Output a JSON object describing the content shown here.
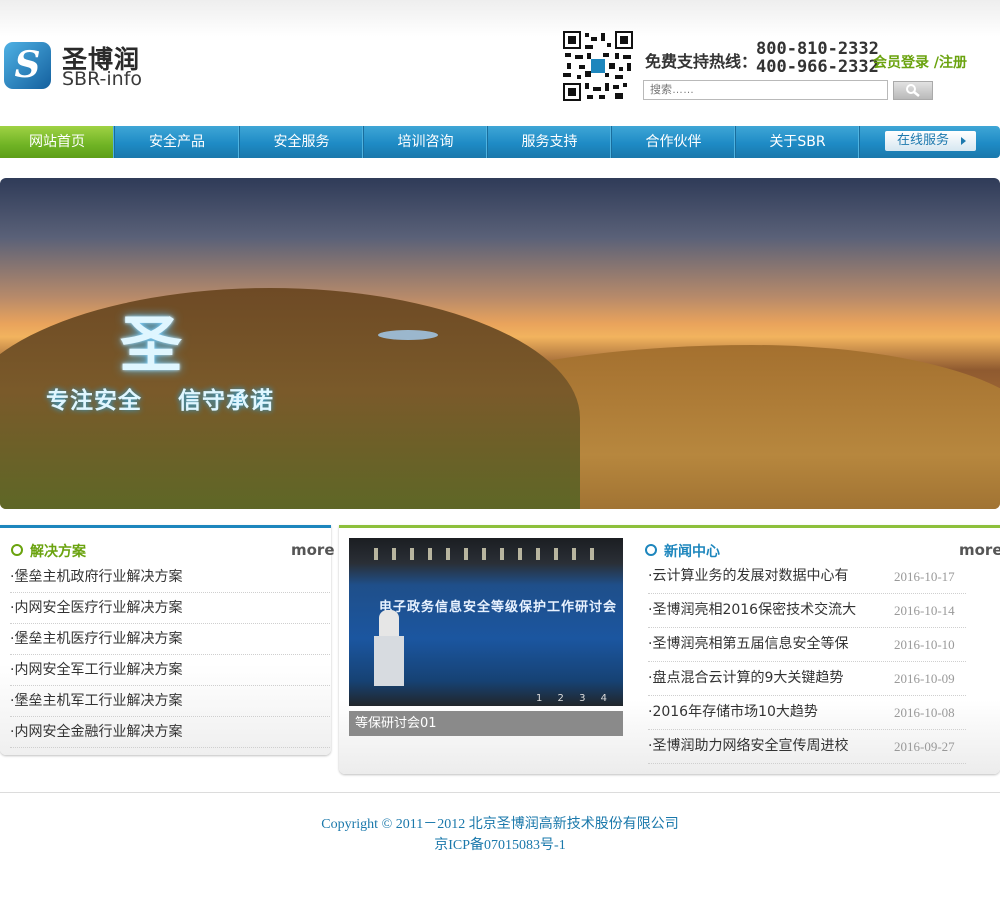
{
  "header": {
    "logo_cn": "圣博润",
    "logo_en": "SBR-info",
    "logo_glyph": "S",
    "hotline_label": "免费支持热线：",
    "phones": [
      "800-810-2332",
      "400-966-2332"
    ],
    "member": "会员登录 /注册",
    "search_placeholder": "搜索……"
  },
  "nav": {
    "items": [
      "网站首页",
      "安全产品",
      "安全服务",
      "培训咨询",
      "服务支持",
      "合作伙伴",
      "关于SBR"
    ],
    "online": "在线服务"
  },
  "banner": {
    "big": "圣",
    "slogan": "专注安全    信守承诺"
  },
  "solutions": {
    "title": "解决方案",
    "more": "more",
    "items": [
      "·堡垒主机政府行业解决方案",
      "·内网安全医疗行业解决方案",
      "·堡垒主机医疗行业解决方案",
      "·内网安全军工行业解决方案",
      "·堡垒主机军工行业解决方案",
      "·内网安全金融行业解决方案"
    ]
  },
  "photo": {
    "screen_text": "电子政务信息安全等级保护工作研讨会",
    "pager": "1 2 3 4",
    "caption": "等保研讨会01"
  },
  "news": {
    "title": "新闻中心",
    "more": "more",
    "items": [
      {
        "title": "·云计算业务的发展对数据中心有",
        "date": "2016-10-17"
      },
      {
        "title": "·圣博润亮相2016保密技术交流大",
        "date": "2016-10-14"
      },
      {
        "title": "·圣博润亮相第五届信息安全等保",
        "date": "2016-10-10"
      },
      {
        "title": "·盘点混合云计算的9大关键趋势",
        "date": "2016-10-09"
      },
      {
        "title": "·2016年存储市场10大趋势",
        "date": "2016-10-08"
      },
      {
        "title": "·圣博润助力网络安全宣传周进校",
        "date": "2016-09-27"
      }
    ]
  },
  "footer": {
    "copyright": "Copyright © 2011－2012 北京圣博润高新技术股份有限公司",
    "icp": "京ICP备07015083号-1"
  },
  "colors": {
    "brand_blue": "#1d86bd",
    "brand_green": "#6aa30e"
  }
}
